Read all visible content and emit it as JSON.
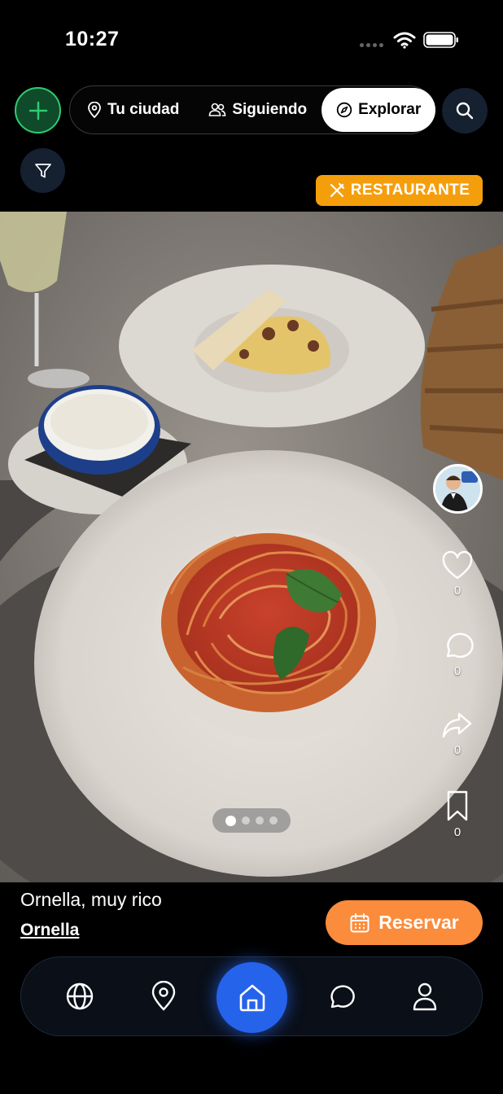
{
  "status_bar": {
    "time": "10:27",
    "icons": [
      "signal-dots-icon",
      "wifi-icon",
      "battery-icon"
    ]
  },
  "header": {
    "add_icon": "plus-icon",
    "tabs": [
      {
        "label": "Tu ciudad",
        "icon": "map-pin-icon",
        "active": false
      },
      {
        "label": "Siguiendo",
        "icon": "users-icon",
        "active": false
      },
      {
        "label": "Explorar",
        "icon": "compass-icon",
        "active": true
      }
    ],
    "search_icon": "search-icon",
    "filter_icon": "filter-icon"
  },
  "post": {
    "category": "RESTAURANTE",
    "category_icon": "utensils-icon",
    "photo_index": 1,
    "photo_count": 4,
    "actions": {
      "likes": "0",
      "comments": "0",
      "shares": "0",
      "saves": "0"
    },
    "caption": "Ornella, muy rico",
    "author": "Ornella",
    "reserve_label": "Reservar"
  },
  "bottom_nav": {
    "items": [
      "globe-icon",
      "map-pin-icon",
      "home-icon",
      "chat-icon",
      "user-icon"
    ],
    "active": "home-icon"
  },
  "colors": {
    "accent_green": "#2ecc71",
    "badge_orange": "#f59e0b",
    "reserve_orange": "#fb8c3c",
    "home_blue": "#2563eb"
  }
}
